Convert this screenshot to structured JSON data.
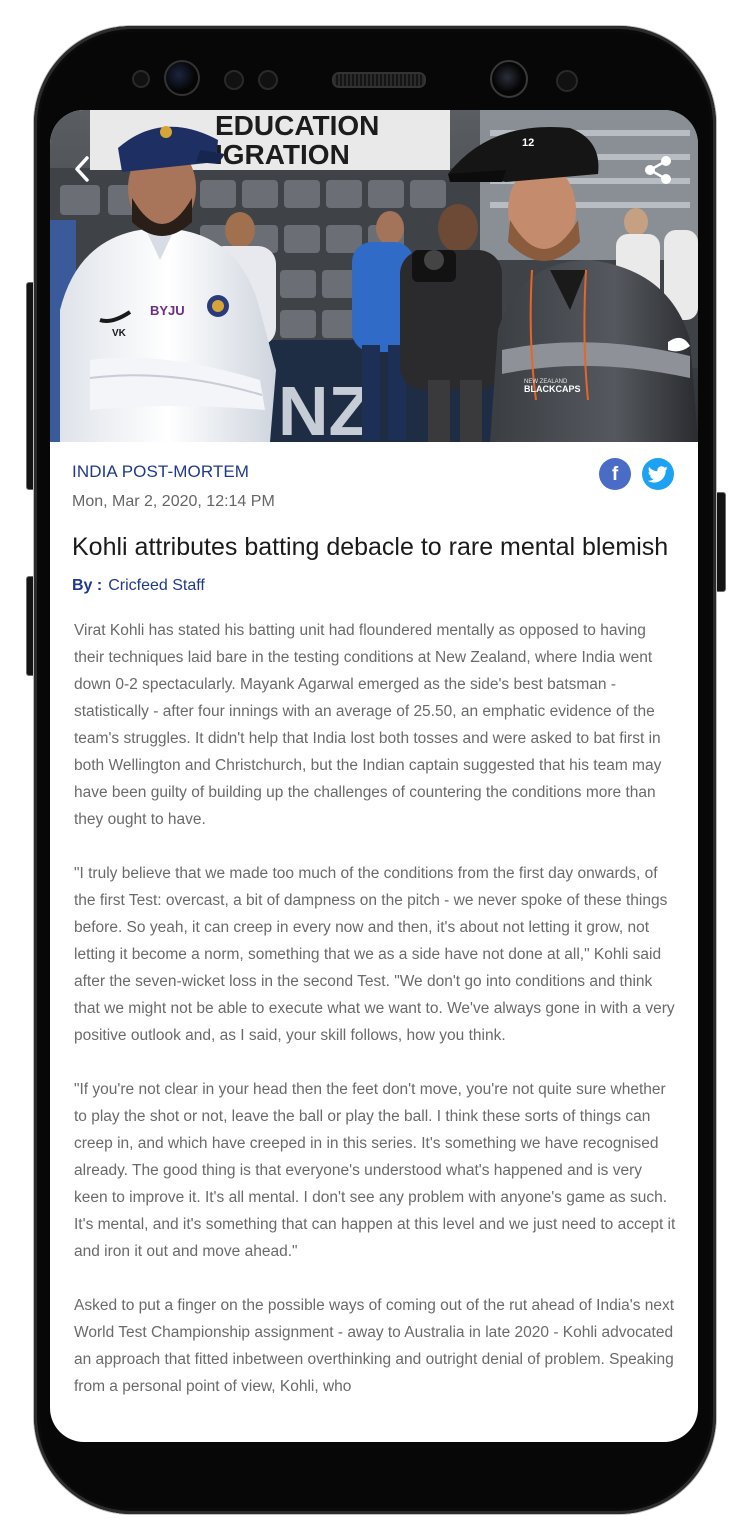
{
  "hero": {
    "banner_text_line1": "EDUCATION",
    "banner_text_line2": "IGRATION",
    "player_left_chest": "BYJU",
    "player_left_logo": "VK",
    "player_right_brand": "BLACKCAPS",
    "player_right_sponsor": "NEW ZEALAND"
  },
  "toolbar": {
    "back_icon": "chevron-left-icon",
    "share_icon": "share-icon"
  },
  "article": {
    "category": "INDIA POST-MORTEM",
    "datetime": "Mon, Mar 2, 2020, 12:14 PM",
    "title": "Kohli attributes batting debacle to rare mental blemish",
    "by_label": "By :",
    "author": "Cricfeed Staff",
    "paragraphs": [
      "Virat Kohli has stated his batting unit had floundered mentally as opposed to having their techniques laid bare in the testing conditions at New Zealand, where India went down 0-2 spectacularly. Mayank Agarwal emerged as the side's best batsman - statistically - after four innings with an average of 25.50, an emphatic evidence of the team's struggles. It didn't help that India lost both tosses and were asked to bat first in both Wellington and Christchurch, but the Indian captain suggested that his team may have been guilty of building up the challenges of countering the conditions more than they ought to have.",
      "\"I truly believe that we made too much of the conditions from the first day onwards, of the first Test: overcast, a bit of dampness on the pitch - we never spoke of these things before. So yeah, it can creep in every now and then, it's about not letting it grow, not letting it become a norm, something that we as a side have not done at all,\" Kohli said after the seven-wicket loss in the second Test. \"We don't go into conditions and think that we might not be able to execute what we want to. We've always gone in with a very positive outlook and, as I said, your skill follows, how you think.",
      "\"If you're not clear in your head then the feet don't move, you're not quite sure whether to play the shot or not, leave the ball or play the ball. I think these sorts of things can creep in, and which have creeped in in this series. It's something we have recognised already. The good thing is that everyone's understood what's happened and is very keen to improve it. It's all mental. I don't see any problem with anyone's game as such. It's mental, and it's something that can happen at this level and we just need to accept it and iron it out and move ahead.\"",
      "Asked to put a finger on the possible ways of coming out of the rut ahead of India's next World Test Championship assignment - away to Australia in late 2020 - Kohli advocated an approach that fitted inbetween overthinking and outright denial of problem. Speaking from a personal point of view, Kohli, who"
    ]
  },
  "social": {
    "facebook_icon": "facebook-icon",
    "facebook_glyph": "f",
    "twitter_icon": "twitter-icon",
    "facebook_color": "#4a6cc7",
    "twitter_color": "#1da1f2"
  },
  "colors": {
    "accent": "#1f3a8a",
    "body_text": "#6a6a6a",
    "title_text": "#1a1a1a"
  }
}
